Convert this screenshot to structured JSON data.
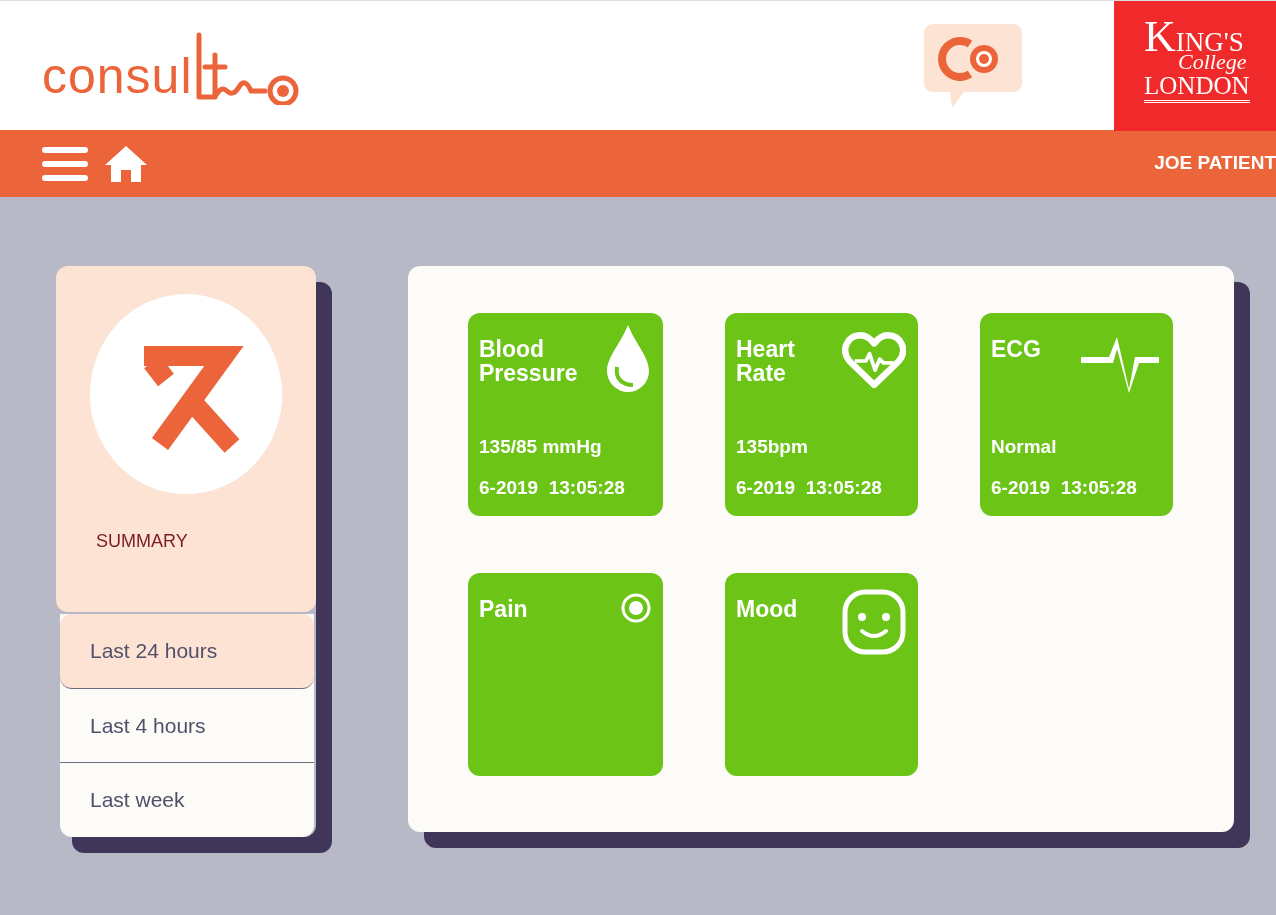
{
  "header": {
    "logo_text": "consul",
    "partner_logo": {
      "line_1": "K",
      "line_1_rest": "ING'S",
      "line_2": "College",
      "line_3": "LONDON"
    }
  },
  "navbar": {
    "user": "JOE PATIENT"
  },
  "summary": {
    "label": "SUMMARY"
  },
  "periods": [
    {
      "label": "Last 24 hours",
      "selected": true
    },
    {
      "label": "Last 4 hours",
      "selected": false
    },
    {
      "label": "Last week",
      "selected": false
    }
  ],
  "tiles": [
    {
      "kind": "drop",
      "title": "Blood Pressure",
      "value": "135/85 mmHg",
      "date": "6-2019",
      "time": "13:05:28"
    },
    {
      "kind": "heart",
      "title": "Heart Rate",
      "value": "135bpm",
      "date": "6-2019",
      "time": "13:05:28"
    },
    {
      "kind": "ecg",
      "title": "ECG",
      "value": "Normal",
      "date": "6-2019",
      "time": "13:05:28"
    },
    {
      "kind": "pain",
      "title": "Pain"
    },
    {
      "kind": "mood",
      "title": "Mood"
    }
  ]
}
